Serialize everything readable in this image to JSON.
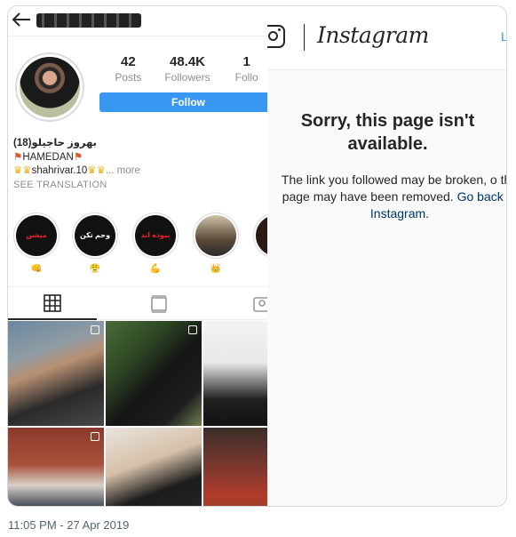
{
  "profile": {
    "back_icon": "arrow-left-icon",
    "stats": [
      {
        "value": "42",
        "label": "Posts"
      },
      {
        "value": "48.4K",
        "label": "Followers"
      },
      {
        "value": "1",
        "label": "Follo"
      }
    ],
    "follow_label": "Follow",
    "bio": {
      "name": "بهروز حاجیلو(18)",
      "line2": "HAMEDAN",
      "line3": "shahrivar.10",
      "more": "... more",
      "translation": "SEE TRANSLATION"
    },
    "highlights": [
      {
        "text": "میشن",
        "emoji": "👊"
      },
      {
        "text": "وحم تکن",
        "emoji": "😤"
      },
      {
        "text": "نبوده اند",
        "emoji": "💪"
      },
      {
        "text": "",
        "emoji": "👑"
      },
      {
        "text": "",
        "emoji": "😂"
      }
    ],
    "tabs": [
      "grid-icon",
      "feed-icon",
      "tagged-icon"
    ]
  },
  "error_page": {
    "brand": "Instagram",
    "login_partial": "Lo",
    "title": "Sorry, this page isn't available.",
    "body_start": "The link you followed may be broken, o the page may have been removed.",
    "link_text": "Go back to Instagram."
  },
  "tweet": {
    "timestamp": "11:05 PM - 27 Apr 2019"
  },
  "colors": {
    "follow_blue": "#3897f0",
    "link_navy": "#003569",
    "muted": "#8e8e8e"
  }
}
